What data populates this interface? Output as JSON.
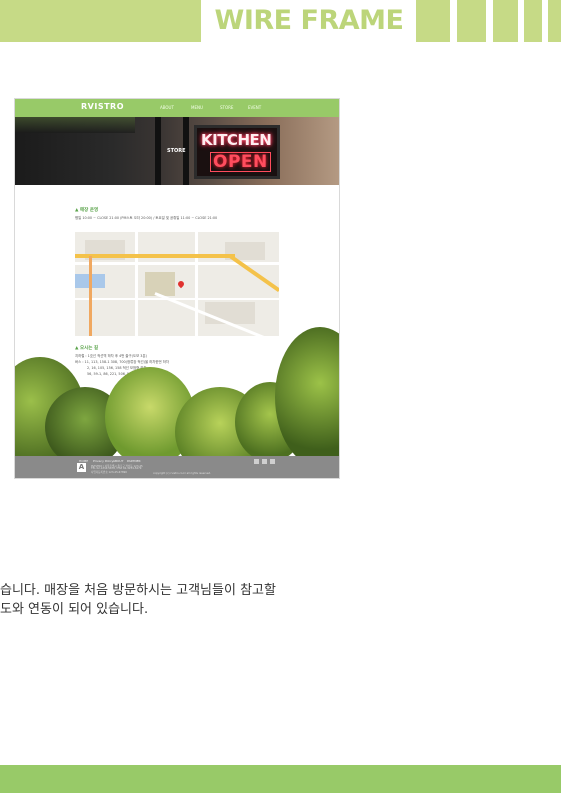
{
  "header": {
    "title": "WIRE FRAME",
    "accent_color": "#c6da86",
    "title_color": "#bcd57a"
  },
  "wireframe": {
    "logo": "RVISTRO",
    "nav": [
      "ABOUT",
      "MENU",
      "STORE",
      "EVENT"
    ],
    "hero": {
      "label": "STORE",
      "sign_top": "KITCHEN",
      "sign_bottom": "OPEN"
    },
    "store_hours": {
      "title": "▲ 매장 운영",
      "line": "평일 10:00 ~ CLOSE 21:00 (PM스토 오더 20:00) / 토요일 및 공휴일 11:00 ~ CLOSE 21:00"
    },
    "directions": {
      "title": "▲ 오시는 길",
      "lines": [
        "지하철 : 1호선 적선역 하차 후 4번 출구(도보 3분)",
        "버스 : 11, 113, 158-1 308, 700(정류장 적선)을 하차한번 하차",
        "2, 16, 105, 156, 158 적선 모범형 하차",
        "56, 59-1, 86, 221, 506, 550 적선역(방처분) 하차"
      ]
    },
    "footer": {
      "links": [
        "HOME",
        "Privacy Policy",
        "ABOUT",
        "PARTNER"
      ],
      "info_lines": [
        "RVISTRO | 서울특별시 종로구 적선동 123-45",
        "TEL 02-1234-5678 / FAX 02-1234-5679",
        "사업자등록번호 123-45-67890"
      ],
      "copyright": "copyright (c) rvistro.co.kr all rights reserved."
    }
  },
  "description": {
    "line1": "습니다. 매장을 처음 방문하시는 고객님들이 참고할",
    "line2": "도와 연동이 되어 있습니다."
  },
  "colors": {
    "nav_green": "#98ca68",
    "footer_gray": "#8a8a8a"
  }
}
